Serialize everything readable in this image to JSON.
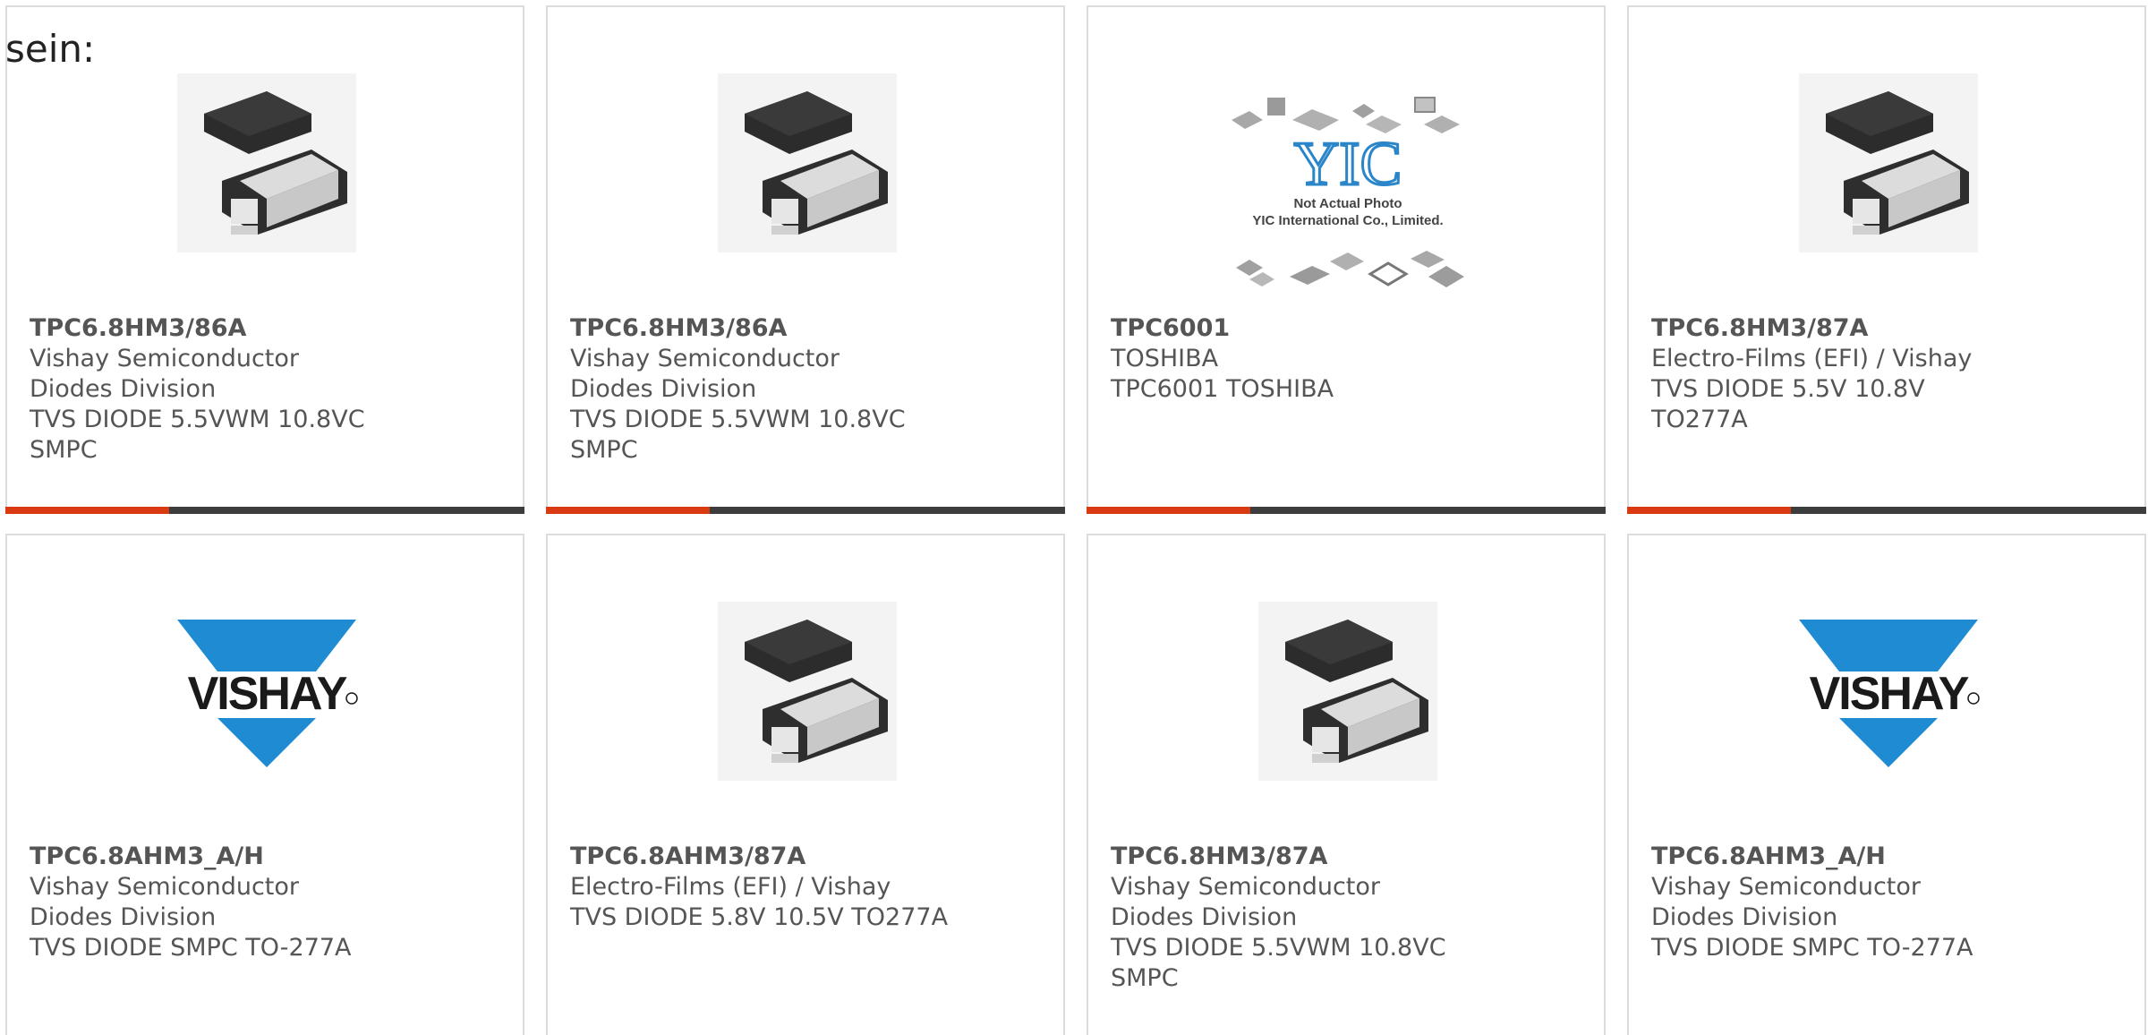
{
  "intro_text": "sein:",
  "colors": {
    "accent": "#d93a12",
    "bar": "#3d3d3d",
    "text": "#555555",
    "border": "#dcdcdc",
    "vishay_blue": "#1e8bd3"
  },
  "products": [
    {
      "part_number": "TPC6.8HM3/86A",
      "manufacturer": "Vishay Semiconductor Diodes Division",
      "description": "TVS DIODE 5.5VWM 10.8VC SMPC",
      "image": "smpc-package-photo"
    },
    {
      "part_number": "TPC6.8HM3/86A",
      "manufacturer": "Vishay Semiconductor Diodes Division",
      "description": "TVS DIODE 5.5VWM 10.8VC SMPC",
      "image": "smpc-package-photo"
    },
    {
      "part_number": "TPC6001",
      "manufacturer": "TOSHIBA",
      "description": "TPC6001 TOSHIBA",
      "image": "yic-placeholder",
      "image_caption_line1": "Not Actual Photo",
      "image_caption_line2": "YIC International Co., Limited.",
      "image_logo_text": "YIC"
    },
    {
      "part_number": "TPC6.8HM3/87A",
      "manufacturer": "Electro-Films (EFI) / Vishay",
      "description": "TVS DIODE 5.5V 10.8V TO277A",
      "image": "smpc-package-photo"
    },
    {
      "part_number": "TPC6.8AHM3_A/H",
      "manufacturer": "Vishay Semiconductor Diodes Division",
      "description": "TVS DIODE SMPC TO-277A",
      "image": "vishay-logo",
      "image_logo_text": "VISHAY"
    },
    {
      "part_number": "TPC6.8AHM3/87A",
      "manufacturer": "Electro-Films (EFI) / Vishay",
      "description": "TVS DIODE 5.8V 10.5V TO277A",
      "image": "smpc-package-photo"
    },
    {
      "part_number": "TPC6.8HM3/87A",
      "manufacturer": "Vishay Semiconductor Diodes Division",
      "description": "TVS DIODE 5.5VWM 10.8VC SMPC",
      "image": "smpc-package-photo"
    },
    {
      "part_number": "TPC6.8AHM3_A/H",
      "manufacturer": "Vishay Semiconductor Diodes Division",
      "description": "TVS DIODE SMPC TO-277A",
      "image": "vishay-logo",
      "image_logo_text": "VISHAY"
    }
  ]
}
